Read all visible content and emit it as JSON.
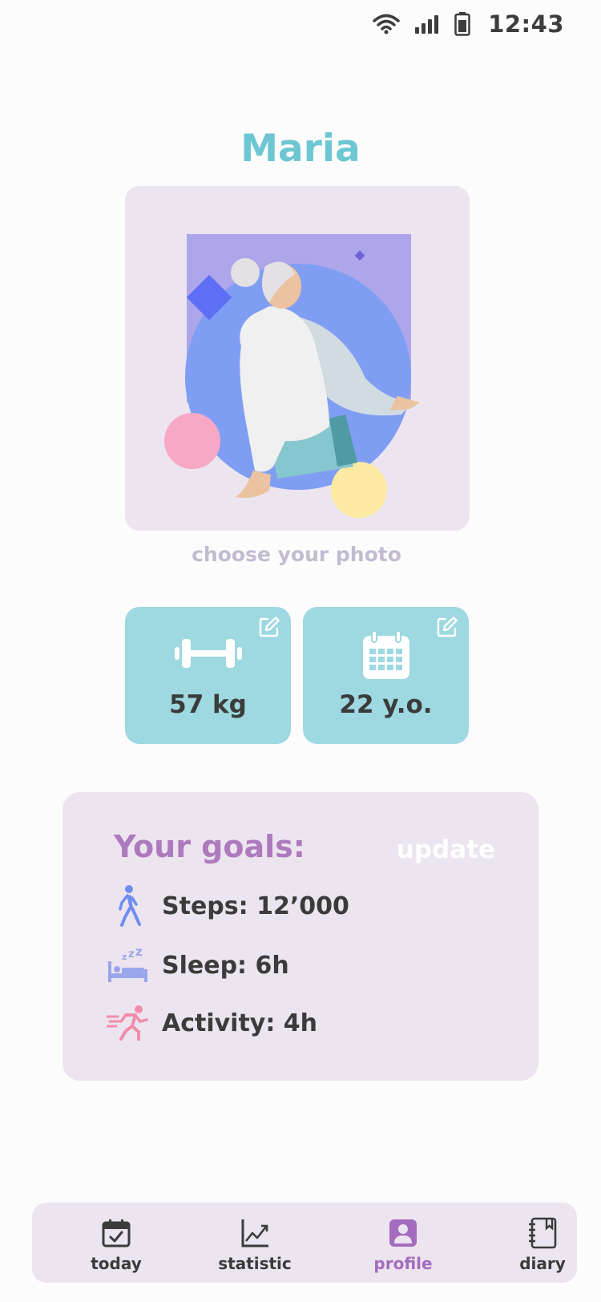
{
  "status_bar": {
    "time": "12:43",
    "icons": [
      "wifi-icon",
      "signal-icon",
      "battery-icon"
    ]
  },
  "profile": {
    "name": "Maria",
    "photo_action": "choose your photo"
  },
  "stats": {
    "weight": {
      "value": "57 kg",
      "icon": "dumbbell-icon",
      "edit_icon": "edit-icon"
    },
    "age": {
      "value": "22 y.o.",
      "icon": "calendar-icon",
      "edit_icon": "edit-icon"
    }
  },
  "goals": {
    "title": "Your goals:",
    "update_label": "update",
    "items": [
      {
        "label": "Steps: 12’000",
        "icon": "walking-icon"
      },
      {
        "label": "Sleep: 6h",
        "icon": "sleep-icon"
      },
      {
        "label": "Activity: 4h",
        "icon": "running-icon"
      }
    ]
  },
  "nav": {
    "active": "profile",
    "items": [
      {
        "label": "today",
        "icon": "calendar-check-icon"
      },
      {
        "label": "statistic",
        "icon": "chart-icon"
      },
      {
        "label": "profile",
        "icon": "profile-icon"
      },
      {
        "label": "diary",
        "icon": "notebook-icon"
      }
    ]
  },
  "colors": {
    "title": "#6cc7d3",
    "card_bg": "#ece4ef",
    "stat_card_bg": "#9ed8e0",
    "accent_purple": "#ad7bbd",
    "active_nav": "#a36cbe",
    "text_dark": "#3b3b3b"
  }
}
